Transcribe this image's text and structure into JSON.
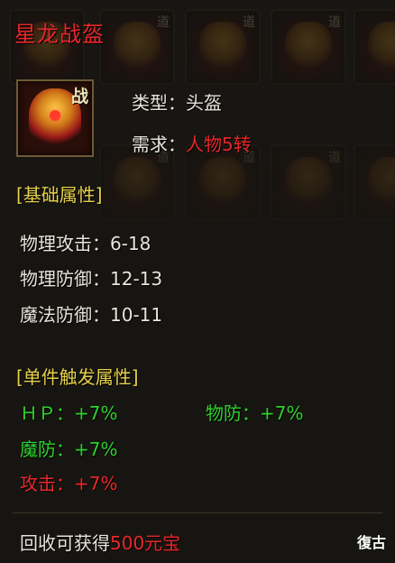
{
  "item": {
    "name": "星龙战盔",
    "badge": "战",
    "type_label": "类型：",
    "type_value": "头盔",
    "require_label": "需求：",
    "require_value": "人物5转"
  },
  "base_section": {
    "header": "[基础属性]",
    "stats": [
      {
        "label": "物理攻击：",
        "value": "6-18"
      },
      {
        "label": "物理防御：",
        "value": "12-13"
      },
      {
        "label": "魔法防御：",
        "value": "10-11"
      }
    ]
  },
  "trigger_section": {
    "header": "[单件触发属性]",
    "hp_label": "ＨＰ：",
    "hp_value": "+7%",
    "wufang_label": "物防：",
    "wufang_value": "+7%",
    "mofang_label": "魔防：",
    "mofang_value": "+7%",
    "attack_label": "攻击：",
    "attack_value": "+7%"
  },
  "footer": {
    "recycle_label": "回收可获得",
    "recycle_value": "500元宝"
  },
  "background_tag": "道",
  "watermark": "復古",
  "colors": {
    "title_red": "#e8272a",
    "section_gold": "#e6d04a",
    "bonus_green": "#2ed12e"
  }
}
